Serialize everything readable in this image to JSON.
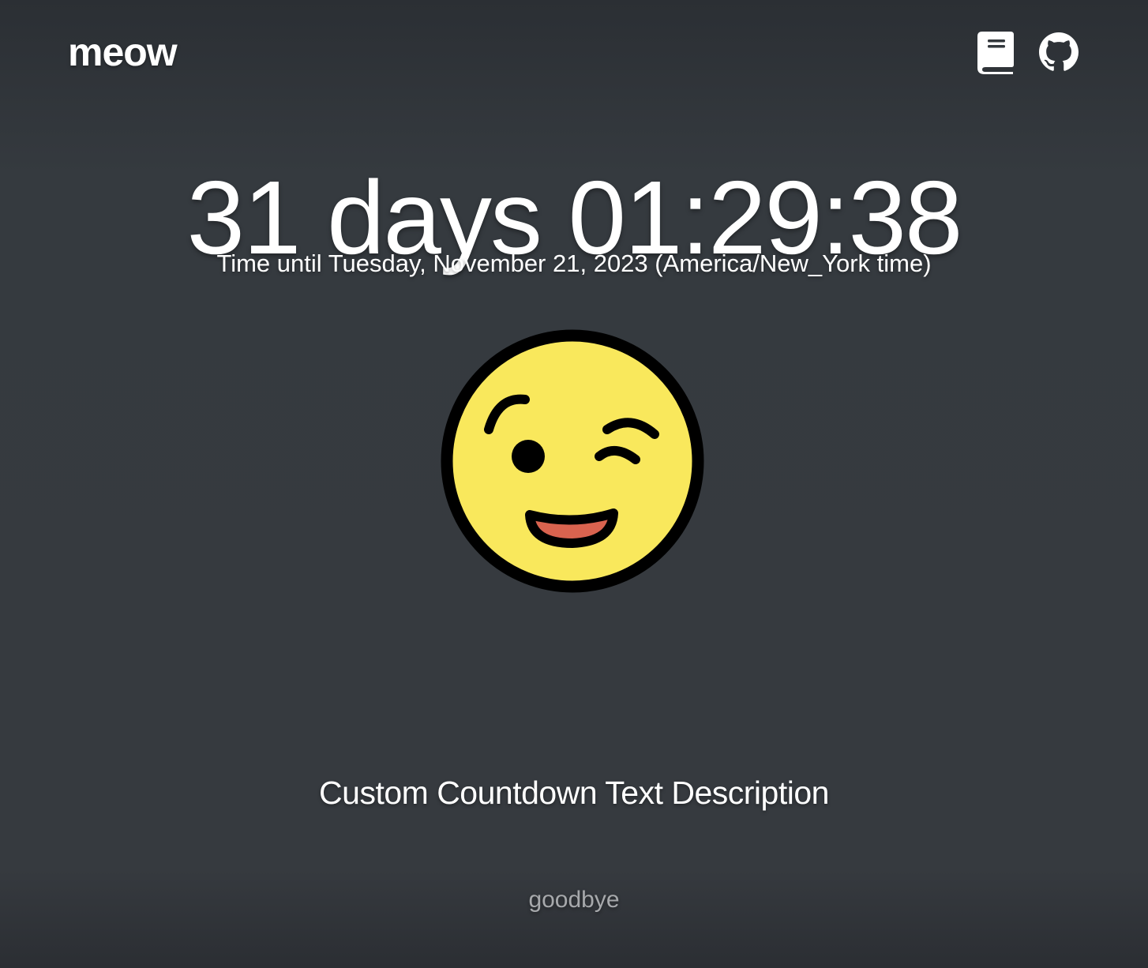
{
  "header": {
    "brand": "meow",
    "icons": [
      "book-icon",
      "github-icon"
    ]
  },
  "countdown": {
    "text": "31 days 01:29:38"
  },
  "subtitle": "Time until Tuesday, November 21, 2023 (America/New_York time)",
  "emoji": {
    "name": "winking-face",
    "face_color": "#f9e85c",
    "outline_color": "#000000",
    "mouth_color": "#d9634f"
  },
  "description": "Custom Countdown Text Description",
  "footer": {
    "text": "goodbye"
  }
}
